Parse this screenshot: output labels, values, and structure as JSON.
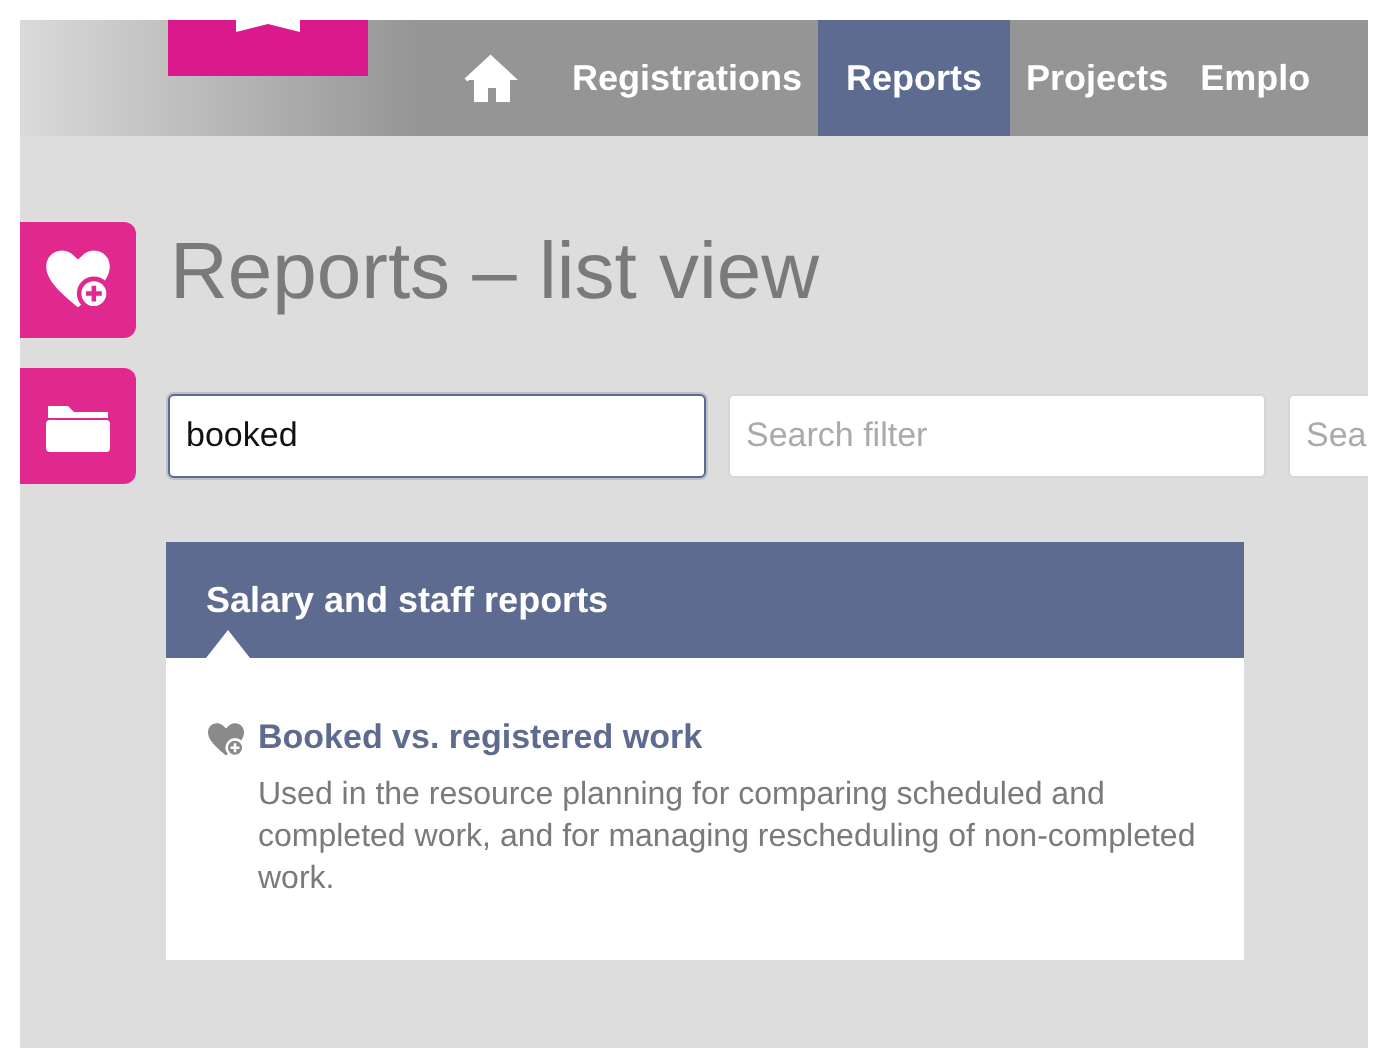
{
  "nav": {
    "items": [
      {
        "kind": "home",
        "selected": false
      },
      {
        "kind": "link",
        "label": "Registrations",
        "selected": false
      },
      {
        "kind": "link",
        "label": "Reports",
        "selected": true
      },
      {
        "kind": "link",
        "label": "Projects",
        "selected": false
      },
      {
        "kind": "link",
        "label": "Emplo",
        "selected": false
      }
    ]
  },
  "title": "Reports – list view",
  "search_fields": [
    {
      "value": "booked",
      "focused": true
    },
    {
      "placeholder": "Search filter",
      "focused": false
    },
    {
      "placeholder": "Sea",
      "focused": false
    }
  ],
  "report_group": {
    "title": "Salary and staff reports",
    "reports": [
      {
        "title": "Booked vs. registered work",
        "description": "Used in the resource planning for comparing scheduled and completed work, and for managing rescheduling of non-completed work."
      }
    ]
  }
}
